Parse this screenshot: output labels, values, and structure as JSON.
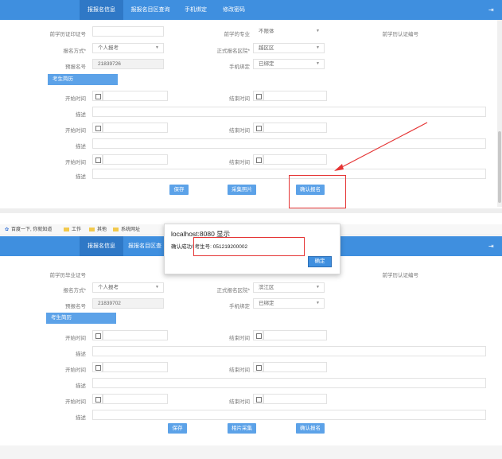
{
  "nav": {
    "tabs": [
      "报报名信息",
      "报报名目区查询",
      "手机绑定",
      "修改密码"
    ],
    "exit_icon": "exit-icon"
  },
  "top_form": {
    "row1": {
      "label_a": "前学历证印证号",
      "label_b": "前学的专业",
      "value_b": "不限体",
      "label_c": "前学历认证编号"
    },
    "row2": {
      "label_a": "报名方式*",
      "value_a": "个人报考",
      "label_b": "正式报名区院*",
      "value_b": "越区区"
    },
    "row3": {
      "label_a": "预报名号",
      "value_a": "21839726",
      "label_b": "手机绑定",
      "value_b": "已绑定"
    },
    "section": "考生简历",
    "rows": [
      {
        "start": "开始时间",
        "end": "结束时间",
        "desc": "描述"
      },
      {
        "start": "开始时间",
        "end": "结束时间",
        "desc": "描述"
      },
      {
        "start": "开始时间",
        "end": "结束时间",
        "desc": "描述"
      }
    ],
    "buttons": {
      "save": "保存",
      "collect": "采集照片",
      "confirm": "确认报名"
    }
  },
  "bookmarks": [
    "百度一下, 你就知道",
    "工作",
    "其他",
    "系统网址"
  ],
  "dialog": {
    "host": "localhost:8080 显示",
    "msg_prefix": "确认成功!",
    "msg_detail": "考生号: 051219200002",
    "ok": "确定"
  },
  "bottom_form": {
    "row1": {
      "label_a": "前学历毕业证号",
      "label_c": "前学历认证编号"
    },
    "row2": {
      "label_a": "报名方式*",
      "value_a": "个人报考",
      "label_b": "正式报名区院*",
      "value_b": "滨江区"
    },
    "row3": {
      "label_a": "预报名号",
      "value_a": "21839702",
      "label_b": "手机绑定",
      "value_b": "已绑定"
    },
    "section": "考生简历",
    "rows": [
      {
        "start": "开始时间",
        "end": "结束时间",
        "desc": "描述"
      },
      {
        "start": "开始时间",
        "end": "结束时间",
        "desc": "描述"
      },
      {
        "start": "开始时间",
        "end": "结束时间",
        "desc": "描述"
      }
    ],
    "buttons": {
      "save": "保存",
      "collect": "相片采集",
      "confirm": "确认报名"
    }
  },
  "colors": {
    "nav": "#3f8fdf",
    "button": "#5ca2e8",
    "annotation": "#e53535"
  }
}
